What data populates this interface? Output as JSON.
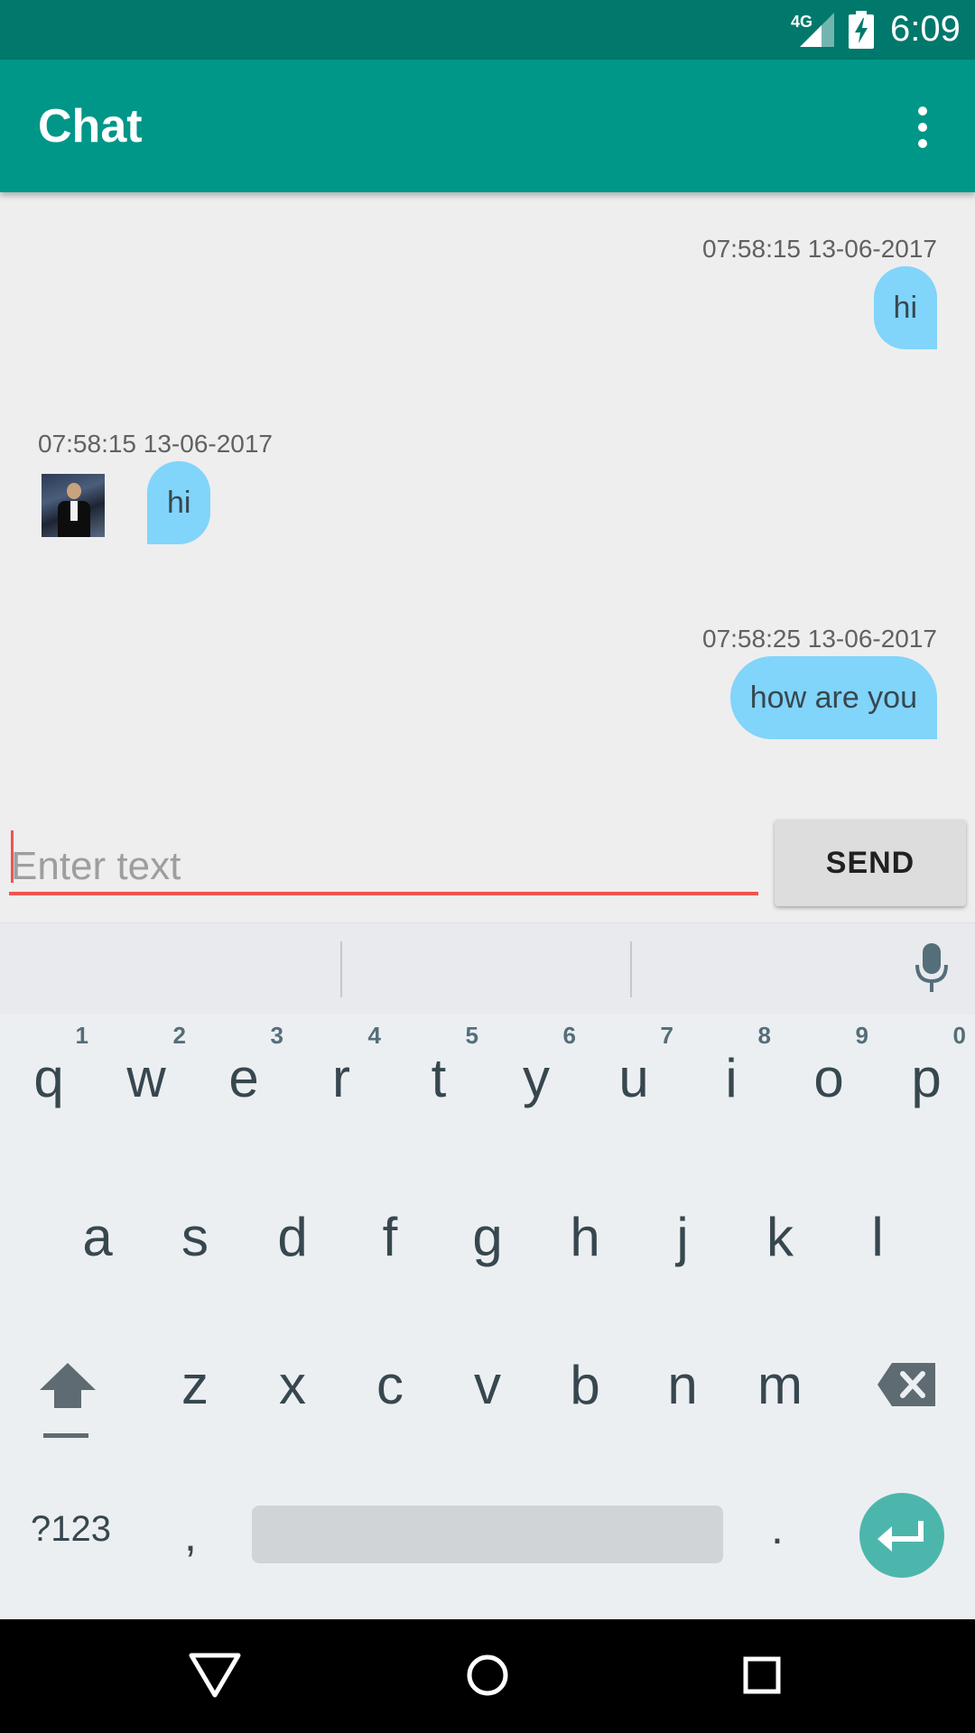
{
  "status_bar": {
    "network": "4G",
    "time": "6:09"
  },
  "toolbar": {
    "title": "Chat",
    "menu_icon": "more-vert-icon"
  },
  "messages": [
    {
      "direction": "outgoing",
      "timestamp": "07:58:15 13-06-2017",
      "text": "hi"
    },
    {
      "direction": "incoming",
      "timestamp": "07:58:15 13-06-2017",
      "text": "hi",
      "avatar": "contact-avatar"
    },
    {
      "direction": "outgoing",
      "timestamp": "07:58:25 13-06-2017",
      "text": "how are you"
    }
  ],
  "composer": {
    "placeholder": "Enter text",
    "value": "",
    "send_label": "SEND"
  },
  "keyboard": {
    "row1": [
      "q",
      "w",
      "e",
      "r",
      "t",
      "y",
      "u",
      "i",
      "o",
      "p"
    ],
    "row1_hints": [
      "1",
      "2",
      "3",
      "4",
      "5",
      "6",
      "7",
      "8",
      "9",
      "0"
    ],
    "row2": [
      "a",
      "s",
      "d",
      "f",
      "g",
      "h",
      "j",
      "k",
      "l"
    ],
    "row3": [
      "z",
      "x",
      "c",
      "v",
      "b",
      "n",
      "m"
    ],
    "symbols_label": "?123",
    "comma": ",",
    "period": ".",
    "icons": [
      "shift-icon",
      "backspace-icon",
      "enter-icon",
      "microphone-icon"
    ]
  },
  "nav_bar": {
    "icons": [
      "back-icon",
      "home-icon",
      "recents-icon"
    ]
  },
  "colors": {
    "primary": "#009688",
    "primary_dark": "#00786c",
    "bubble": "#81d4fa",
    "accent": "#ef5350",
    "enter_key": "#4db6ac"
  }
}
